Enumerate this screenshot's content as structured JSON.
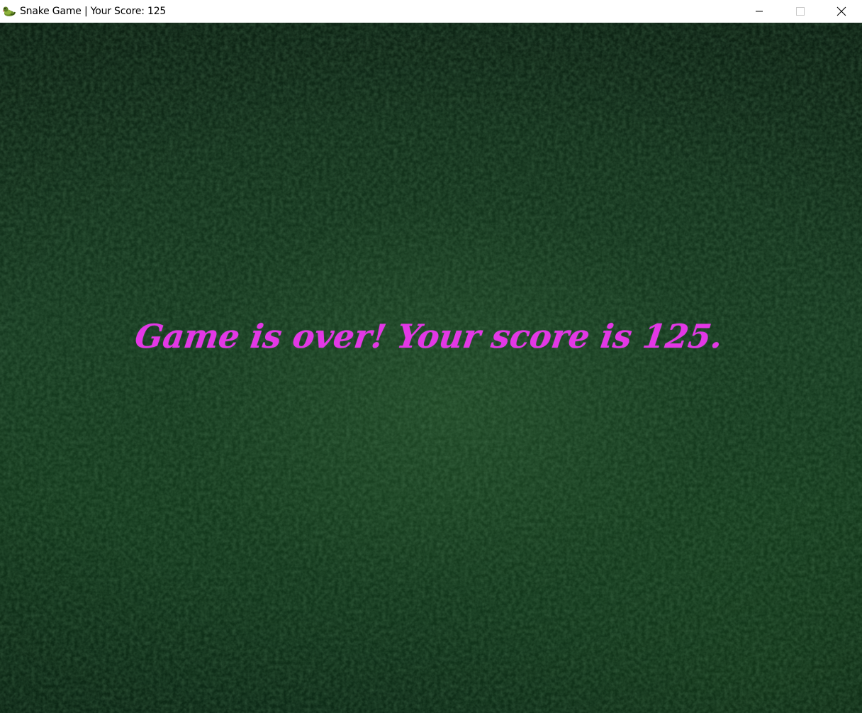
{
  "window": {
    "title": "Snake Game | Your Score: 125",
    "icon": "snake-icon",
    "controls": {
      "minimize_icon": "minimize-icon",
      "maximize_icon": "maximize-icon",
      "close_icon": "close-icon"
    }
  },
  "game": {
    "message": "Game is over! Your score is 125.",
    "score": 125,
    "colors": {
      "message": "#e337e6",
      "background": "#163a20"
    }
  }
}
